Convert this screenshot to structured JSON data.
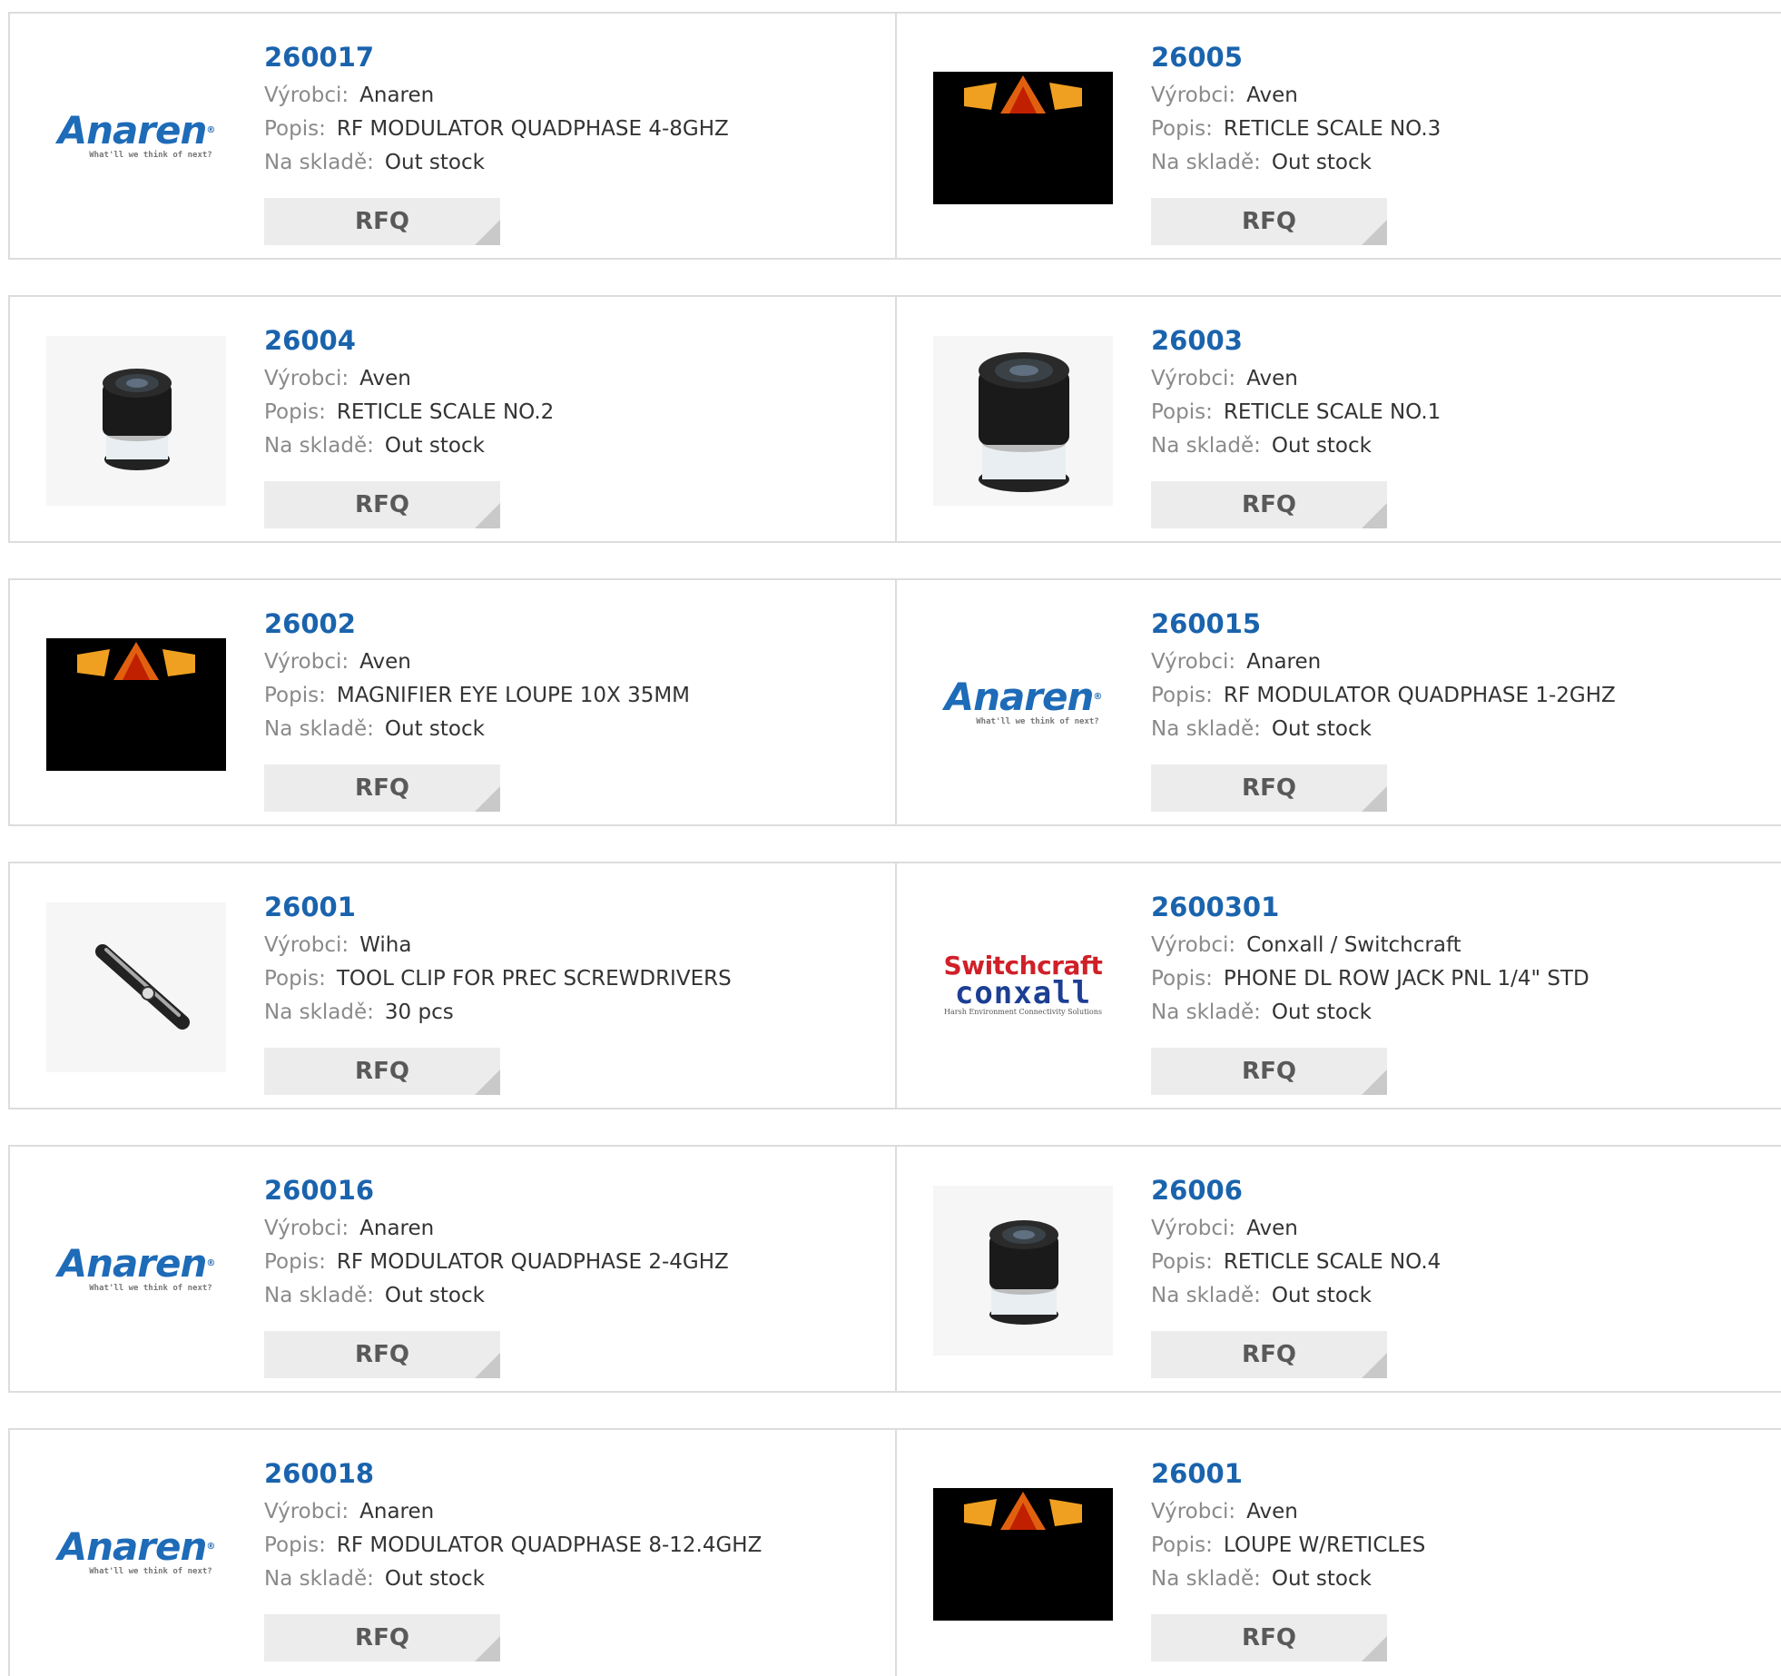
{
  "labels": {
    "manufacturer": "Výrobci:",
    "description": "Popis:",
    "stock": "Na skladě:",
    "rfq": "RFQ"
  },
  "logos": {
    "anaren": "Anaren",
    "anaren_tagline": "What'll we think of next?",
    "switchcraft_top": "Switchcraft",
    "switchcraft_bottom": "conxall",
    "switchcraft_tagline": "Harsh Environment Connectivity Solutions"
  },
  "colors": {
    "part_number": "#1a63ad",
    "label": "#8a8a8a",
    "value": "#333333",
    "button_bg": "#ececec",
    "border": "#dcdcdc"
  },
  "products": [
    {
      "part": "260017",
      "manufacturer": "Anaren",
      "description": "RF MODULATOR QUADPHASE 4-8GHZ",
      "stock": "Out stock",
      "thumb": "anaren-logo"
    },
    {
      "part": "26005",
      "manufacturer": "Aven",
      "description": "RETICLE SCALE NO.3",
      "stock": "Out stock",
      "thumb": "aven-placeholder-image"
    },
    {
      "part": "26004",
      "manufacturer": "Aven",
      "description": "RETICLE SCALE NO.2",
      "stock": "Out stock",
      "thumb": "loupe-photo"
    },
    {
      "part": "26003",
      "manufacturer": "Aven",
      "description": "RETICLE SCALE NO.1",
      "stock": "Out stock",
      "thumb": "loupe-photo"
    },
    {
      "part": "26002",
      "manufacturer": "Aven",
      "description": "MAGNIFIER EYE LOUPE 10X 35MM",
      "stock": "Out stock",
      "thumb": "aven-placeholder-image"
    },
    {
      "part": "260015",
      "manufacturer": "Anaren",
      "description": "RF MODULATOR QUADPHASE 1-2GHZ",
      "stock": "Out stock",
      "thumb": "anaren-logo"
    },
    {
      "part": "26001",
      "manufacturer": "Wiha",
      "description": "TOOL CLIP FOR PREC SCREWDRIVERS",
      "stock": "30 pcs",
      "thumb": "tool-clip-photo"
    },
    {
      "part": "2600301",
      "manufacturer": "Conxall / Switchcraft",
      "description": "PHONE DL ROW JACK PNL 1/4\" STD",
      "stock": "Out stock",
      "thumb": "switchcraft-logo"
    },
    {
      "part": "260016",
      "manufacturer": "Anaren",
      "description": "RF MODULATOR QUADPHASE 2-4GHZ",
      "stock": "Out stock",
      "thumb": "anaren-logo"
    },
    {
      "part": "26006",
      "manufacturer": "Aven",
      "description": "RETICLE SCALE NO.4",
      "stock": "Out stock",
      "thumb": "loupe-photo"
    },
    {
      "part": "260018",
      "manufacturer": "Anaren",
      "description": "RF MODULATOR QUADPHASE 8-12.4GHZ",
      "stock": "Out stock",
      "thumb": "anaren-logo"
    },
    {
      "part": "26001",
      "manufacturer": "Aven",
      "description": "LOUPE W/RETICLES",
      "stock": "Out stock",
      "thumb": "aven-placeholder-image"
    }
  ]
}
